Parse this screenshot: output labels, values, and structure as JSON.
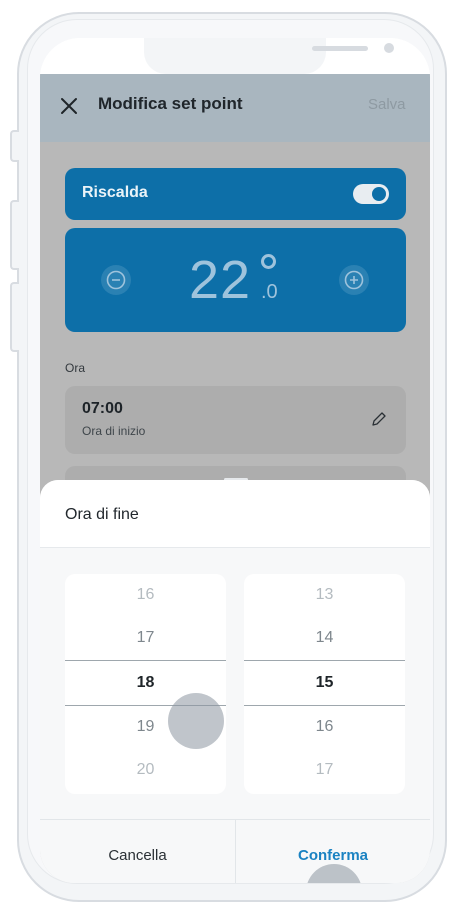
{
  "header": {
    "title": "Modifica set point",
    "save_label": "Salva"
  },
  "mode": {
    "label": "Riscalda",
    "enabled": true
  },
  "temperature": {
    "integer": "22",
    "decimal": ".0"
  },
  "time_section": {
    "label": "Ora",
    "start": {
      "value": "07:00",
      "label": "Ora di inizio"
    }
  },
  "sheet": {
    "title": "Ora di fine",
    "hours": [
      "16",
      "17",
      "18",
      "19",
      "20"
    ],
    "minutes": [
      "13",
      "14",
      "15",
      "16",
      "17"
    ],
    "selected_hour": "18",
    "selected_minute": "15",
    "cancel_label": "Cancella",
    "confirm_label": "Conferma"
  },
  "colors": {
    "accent": "#0d6fa8",
    "confirm": "#1a82c2",
    "overlay": "#b8b8b8"
  }
}
